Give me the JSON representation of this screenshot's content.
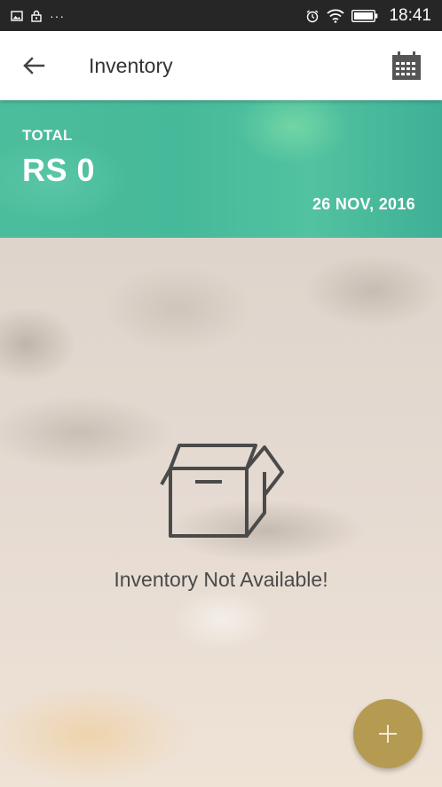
{
  "status_bar": {
    "time": "18:41",
    "left_icons": [
      "image-icon",
      "lock-icon"
    ],
    "overflow": "···",
    "right_icons": [
      "alarm-icon",
      "wifi-icon",
      "battery-icon"
    ]
  },
  "app_bar": {
    "title": "Inventory",
    "back_icon": "arrow-back-icon",
    "calendar_icon": "calendar-icon"
  },
  "banner": {
    "label": "TOTAL",
    "value": "RS 0",
    "date": "26 NOV, 2016",
    "color": "#4cbd9c"
  },
  "empty_state": {
    "icon": "open-box-icon",
    "message": "Inventory Not Available!"
  },
  "fab": {
    "icon": "plus-icon",
    "color": "#b59a52"
  }
}
